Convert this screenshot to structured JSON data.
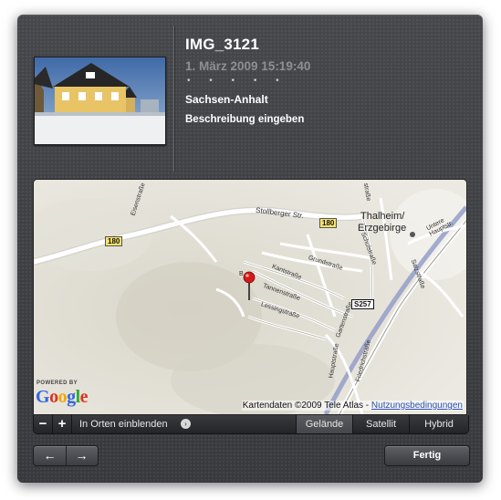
{
  "photo": {
    "title": "IMG_3121",
    "date": "1. März 2009 15:19:40",
    "rating_dots": "• • • • •",
    "place": "Sachsen-Anhalt",
    "description_placeholder": "Beschreibung eingeben"
  },
  "map": {
    "powered_by": "POWERED BY",
    "google_logo": "Google",
    "copyright": "Kartendaten ©2009 Tele Atlas - ",
    "terms_link": "Nutzungsbedingungen",
    "labels": {
      "town": "Thalheim/",
      "town2": "Erzgebirge",
      "road_a": "Stollberger Str.",
      "route_180_a": "180",
      "route_180_b": "180",
      "route_s257": "S257",
      "grundstrasse": "Grundstraße",
      "kantstrasse": "Kantstraße",
      "tannenstrasse": "Tannenstraße",
      "lessingstrasse": "Lessingstraße",
      "gartenstrasse": "Gartenstraße",
      "hauptstrasse": "Hauptstraße",
      "friedrichstrasse": "Friedrichstraße",
      "schulstrasse": "Schulstraße",
      "salzstrasse": "Salzstraße",
      "untere_hauptstrasse": "Untere Hauptstr.",
      "eisenstrasse": "Eisenstraße",
      "top_strasse": "straße",
      "b_label": "B"
    }
  },
  "mapbar": {
    "zoom_out": "−",
    "zoom_in": "+",
    "show_in_places": "In Orten einblenden",
    "arrow": "›",
    "map_types": [
      "Gelände",
      "Satellit",
      "Hybrid"
    ],
    "active_map_type": "Gelände"
  },
  "footer": {
    "prev": "←",
    "next": "→",
    "done": "Fertig"
  }
}
